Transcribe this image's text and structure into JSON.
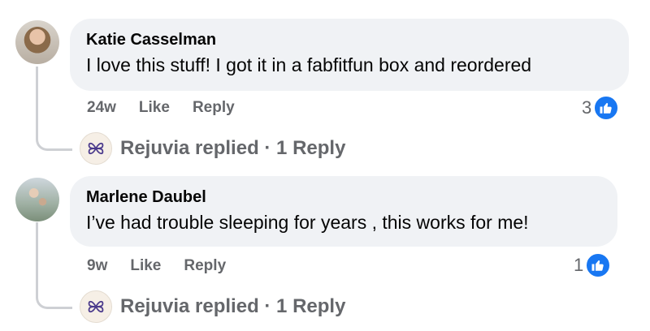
{
  "comments": [
    {
      "author": "Katie Casselman",
      "text": "I love this stuff! I got it in a fabfitfun box and reordered",
      "time": "24w",
      "like_label": "Like",
      "reply_label": "Reply",
      "reaction_count": "3",
      "reply_summary": "Rejuvia replied · 1 Reply"
    },
    {
      "author": "Marlene Daubel",
      "text": "I’ve had trouble sleeping for years , this works for me!",
      "time": "9w",
      "like_label": "Like",
      "reply_label": "Reply",
      "reaction_count": "1",
      "reply_summary": "Rejuvia replied · 1 Reply"
    }
  ],
  "icons": {
    "reaction": "thumbs-up-icon",
    "page_logo": "rejuvia-logo-icon"
  },
  "colors": {
    "bubble": "#f0f2f5",
    "like_blue": "#1877f2",
    "muted_text": "#65676b",
    "logo_purple": "#4b3a8c"
  }
}
